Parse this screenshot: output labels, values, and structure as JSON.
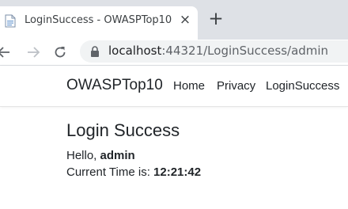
{
  "browser": {
    "tab": {
      "title": "LoginSuccess - OWASPTop10",
      "close_glyph": "×",
      "favicon_icon": "page-icon"
    },
    "new_tab_glyph": "+",
    "address": {
      "host": "localhost",
      "rest": ":44321/LoginSuccess/admin",
      "lock_icon": "lock-icon"
    },
    "colors": {
      "tabstrip": "#dee1e6",
      "omnibox": "#f1f3f4"
    }
  },
  "site": {
    "brand": "OWASPTop10",
    "nav": {
      "home": "Home",
      "privacy": "Privacy",
      "login_success": "LoginSuccess"
    }
  },
  "main": {
    "title": "Login Success",
    "greeting_prefix": "Hello, ",
    "username": "admin",
    "time_prefix": "Current Time is: ",
    "time_value": "12:21:42"
  }
}
